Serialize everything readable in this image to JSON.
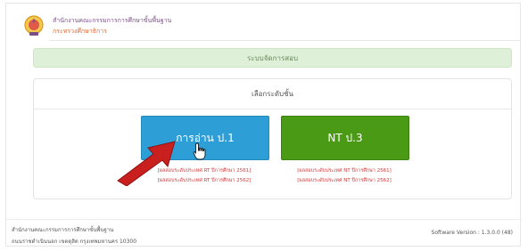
{
  "header": {
    "org_name": "สำนักงานคณะกรรมการการศึกษาขั้นพื้นฐาน",
    "ministry": "กระทรวงศึกษาธิการ"
  },
  "banner": {
    "title": "ระบบจัดการสอบ"
  },
  "panel": {
    "title": "เลือกระดับชั้น",
    "buttons": [
      {
        "label": "การอ่าน ป.1",
        "color": "#2d9fd6"
      },
      {
        "label": "NT ป.3",
        "color": "#4b9a16"
      }
    ],
    "links": [
      "[ผลสอบระดับประเทศ RT ปีการศึกษา 2561]",
      "[ผลสอบระดับประเทศ RT ปีการศึกษา 2562]",
      "[ผลสอบระดับประเทศ NT ปีการศึกษา 2561]",
      "[ผลสอบระดับประเทศ NT ปีการศึกษา 2562]"
    ]
  },
  "footer": {
    "org_name": "สำนักงานคณะกรรมการการศึกษาขั้นพื้นฐาน",
    "address": "ถนนราชดำเนินนอก เขตดุสิต กรุงเทพมหานคร 10300",
    "version": "Software Version : 1.3.0.0 (48)"
  },
  "colors": {
    "accent_red": "#d23a3a",
    "banner_green": "#dff0d8"
  }
}
